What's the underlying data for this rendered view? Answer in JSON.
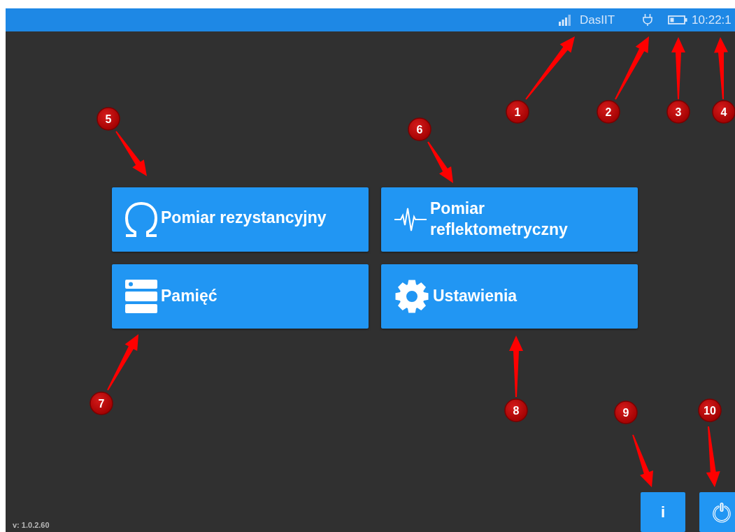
{
  "status_bar": {
    "network_name": "DasIIT",
    "time": "10:22:1"
  },
  "menu_buttons": [
    {
      "kind": "resistance",
      "label": "Pomiar rezystancyjny"
    },
    {
      "kind": "reflectometry",
      "label": "Pomiar reflektometryczny"
    },
    {
      "kind": "memory",
      "label": "Pamięć"
    },
    {
      "kind": "settings",
      "label": "Ustawienia"
    }
  ],
  "version": "v: 1.0.2.60",
  "bottom_buttons": [
    {
      "kind": "info",
      "label": "i"
    },
    {
      "kind": "power"
    }
  ],
  "callouts": [
    {
      "number": "1"
    },
    {
      "number": "2"
    },
    {
      "number": "3"
    },
    {
      "number": "4"
    },
    {
      "number": "5"
    },
    {
      "number": "6"
    },
    {
      "number": "7"
    },
    {
      "number": "8"
    },
    {
      "number": "9"
    },
    {
      "number": "10"
    }
  ]
}
